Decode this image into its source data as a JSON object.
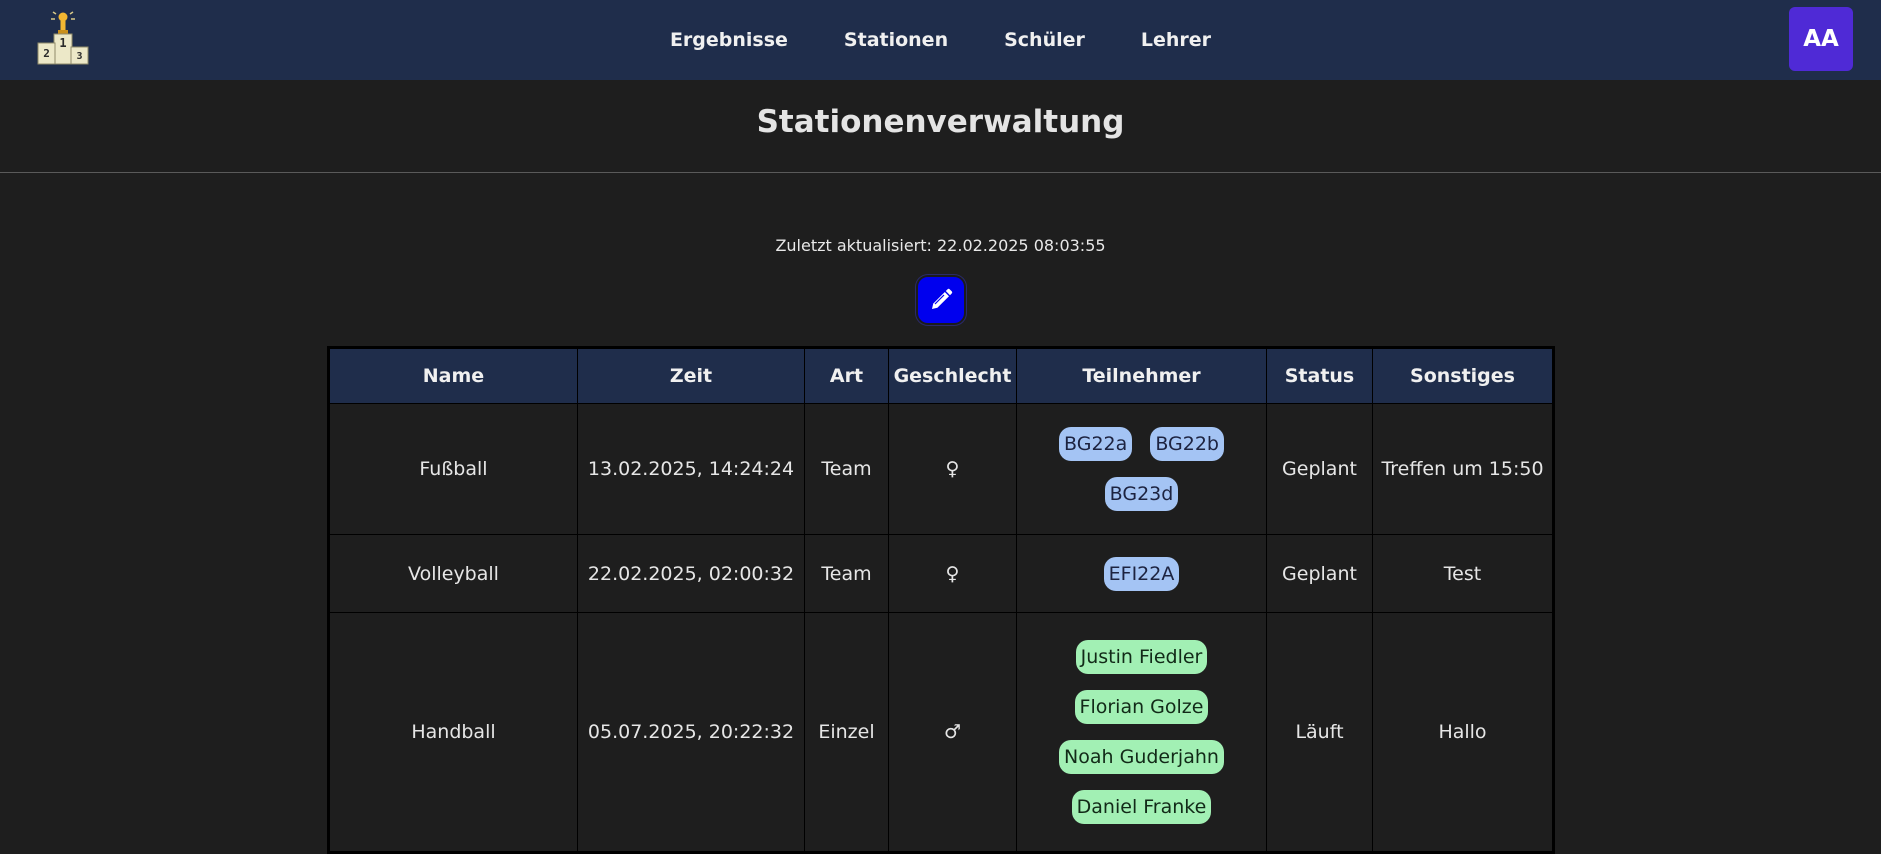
{
  "nav": {
    "links": [
      "Ergebnisse",
      "Stationen",
      "Schüler",
      "Lehrer"
    ],
    "avatar": "AA",
    "logo_digits": [
      "2",
      "1",
      "3"
    ]
  },
  "page": {
    "title": "Stationenverwaltung",
    "updated": "Zuletzt aktualisiert: 22.02.2025 08:03:55",
    "edit_icon": "pencil-icon"
  },
  "table": {
    "headers": [
      "Name",
      "Zeit",
      "Art",
      "Geschlecht",
      "Teilnehmer",
      "Status",
      "Sonstiges"
    ],
    "rows": [
      {
        "name": "Fußball",
        "time": "13.02.2025, 14:24:24",
        "type": "Team",
        "gender": "♀",
        "participants": [
          "BG22a",
          "BG22b",
          "BG23d"
        ],
        "status": "Geplant",
        "other": "Treffen um 15:50"
      },
      {
        "name": "Volleyball",
        "time": "22.02.2025, 02:00:32",
        "type": "Team",
        "gender": "♀",
        "participants": [
          "EFI22A"
        ],
        "status": "Geplant",
        "other": "Test"
      },
      {
        "name": "Handball",
        "time": "05.07.2025, 20:22:32",
        "type": "Einzel",
        "gender": "♂",
        "participants": [
          "Justin Fiedler",
          "Florian Golze",
          "Noah Guderjahn",
          "Daniel Franke"
        ],
        "status": "Läuft",
        "other": "Hallo"
      }
    ]
  },
  "colors": {
    "navbar": "#1f2d4b",
    "avatar": "#4f2ad6",
    "edit_button": "#0000ee",
    "class_tag": "#a4c4f4",
    "student_tag": "#a2f0b4"
  }
}
